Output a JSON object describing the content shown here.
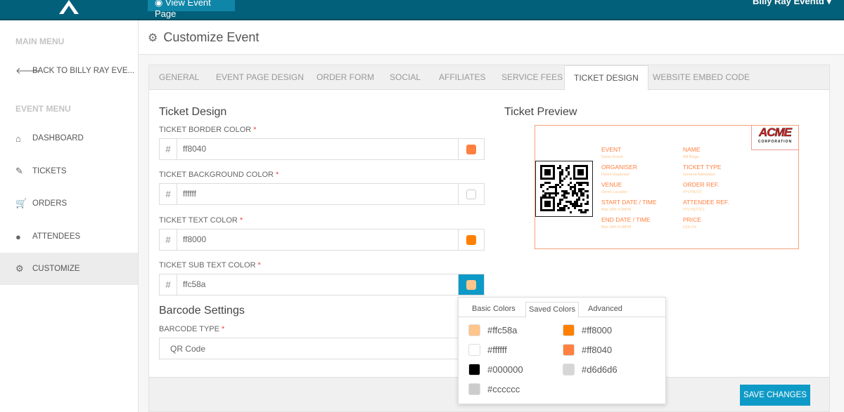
{
  "topbar": {
    "view_event_label": "View Event Page",
    "user_name": "Billy Ray Eventd"
  },
  "sidebar": {
    "main_menu": "MAIN MENU",
    "back_label": "BACK TO BILLY RAY EVE...",
    "event_menu": "EVENT MENU",
    "items": [
      {
        "label": "DASHBOARD",
        "icon": "home-icon"
      },
      {
        "label": "TICKETS",
        "icon": "ticket-icon"
      },
      {
        "label": "ORDERS",
        "icon": "cart-icon"
      },
      {
        "label": "ATTENDEES",
        "icon": "user-icon"
      },
      {
        "label": "CUSTOMIZE",
        "icon": "gear-icon",
        "active": true
      }
    ]
  },
  "page": {
    "title": "Customize Event"
  },
  "tabs": [
    "GENERAL",
    "EVENT PAGE DESIGN",
    "ORDER FORM",
    "SOCIAL",
    "AFFILIATES",
    "SERVICE FEES",
    "TICKET DESIGN",
    "WEBSITE EMBED CODE"
  ],
  "active_tab": "TICKET DESIGN",
  "ticket_design": {
    "heading": "Ticket Design",
    "fields": [
      {
        "label": "TICKET BORDER COLOR",
        "value": "ff8040",
        "color": "#ff8040"
      },
      {
        "label": "TICKET BACKGROUND COLOR",
        "value": "ffffff",
        "color": "#ffffff"
      },
      {
        "label": "TICKET TEXT COLOR",
        "value": "ff8000",
        "color": "#ff8000"
      },
      {
        "label": "TICKET SUB TEXT COLOR",
        "value": "ffc58a",
        "color": "#ffc58a"
      }
    ],
    "hash": "#",
    "required": "*"
  },
  "barcode": {
    "heading": "Barcode Settings",
    "label": "BARCODE TYPE",
    "value": "QR Code"
  },
  "preview": {
    "heading": "Ticket Preview",
    "logo_text": "ACME",
    "logo_sub": "CORPORATION",
    "left": [
      {
        "label": "EVENT",
        "value": "Demo Event"
      },
      {
        "label": "ORGANISER",
        "value": "Demo Organiser"
      },
      {
        "label": "VENUE",
        "value": "Demo Location"
      },
      {
        "label": "START DATE / TIME",
        "value": "Mar 18th 4:08PM"
      },
      {
        "label": "END DATE / TIME",
        "value": "Mar 18th 5:08PM"
      }
    ],
    "right": [
      {
        "label": "NAME",
        "value": "Bill Blogs"
      },
      {
        "label": "TICKET TYPE",
        "value": "General Admission"
      },
      {
        "label": "ORDER REF.",
        "value": "#YLY9U73"
      },
      {
        "label": "ATTENDEE REF.",
        "value": "#YLY9U73-1"
      },
      {
        "label": "PRICE",
        "value": "£XX.XX"
      }
    ]
  },
  "color_picker": {
    "tabs": [
      "Basic Colors",
      "Saved Colors",
      "Advanced"
    ],
    "active_tab": "Saved Colors",
    "saved": [
      "#ffc58a",
      "#ff8000",
      "#ffffff",
      "#ff8040",
      "#000000",
      "#d6d6d6",
      "#cccccc"
    ]
  },
  "footer": {
    "save_label": "SAVE CHANGES"
  },
  "colors": {
    "topbar": "#03607a",
    "accent": "#0e9ac7"
  }
}
